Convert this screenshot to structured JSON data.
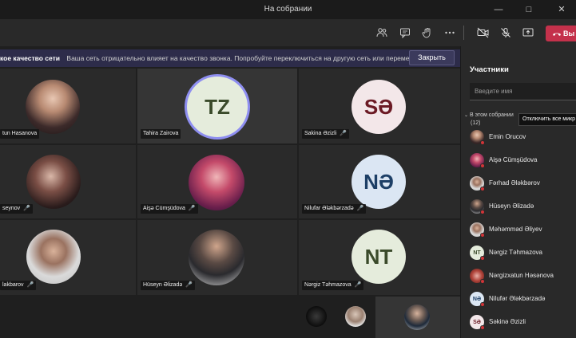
{
  "window": {
    "title": "На собрании"
  },
  "toolbar": {
    "icons": [
      "people-icon",
      "chat-icon",
      "raise-hand-icon",
      "more-icon",
      "camera-off-icon",
      "mic-off-icon",
      "share-icon"
    ],
    "leave_label": "Вы",
    "leave_color": "#c4314b"
  },
  "banner": {
    "title": "кое качество сети",
    "message": "Ваша сеть отрицательно влияет на качество звонка. Попробуйте переключиться на другую сеть или перемест...",
    "close_label": "Закрыть"
  },
  "tiles": [
    {
      "name": "tun Hasanova",
      "avatar_type": "photo",
      "muted": false
    },
    {
      "name": "Tahira Zairova",
      "avatar_type": "initials",
      "initials": "TZ",
      "muted": false,
      "speaking": true
    },
    {
      "name": "Sakina Əzizli",
      "avatar_type": "initials",
      "initials": "SƏ",
      "muted": true
    },
    {
      "name": "seynov",
      "avatar_type": "photo",
      "muted": true
    },
    {
      "name": "Aişə Cümşüdova",
      "avatar_type": "photo",
      "muted": true
    },
    {
      "name": "Nilufar Ələkbərzadə",
      "avatar_type": "initials",
      "initials": "NƏ",
      "muted": true
    },
    {
      "name": "lakbarov",
      "avatar_type": "photo",
      "muted": true
    },
    {
      "name": "Hüseyn Əlizadə",
      "avatar_type": "photo",
      "muted": true
    },
    {
      "name": "Nərgiz Təhmazova",
      "avatar_type": "initials",
      "initials": "NT",
      "muted": true
    }
  ],
  "panel": {
    "title": "Участники",
    "search_placeholder": "Введите имя",
    "section_label": "В этом собрании",
    "section_count": "(12)",
    "mute_all_label": "Отключить все микр",
    "participants": [
      {
        "name": "Emin Orucov",
        "initials": ""
      },
      {
        "name": "Aişə Cümşüdova",
        "initials": ""
      },
      {
        "name": "Fərhad Ələkbərov",
        "initials": ""
      },
      {
        "name": "Hüseyn Əlizadə",
        "initials": ""
      },
      {
        "name": "Məhəmməd Əliyev",
        "initials": ""
      },
      {
        "name": "Nərgiz Təhmazova",
        "initials": "NT"
      },
      {
        "name": "Nərgizxatun Həsənova",
        "initials": ""
      },
      {
        "name": "Nilufər Ələkbərzadə",
        "initials": "NƏ"
      },
      {
        "name": "Səkinə Əzizli",
        "initials": "SƏ"
      }
    ]
  }
}
